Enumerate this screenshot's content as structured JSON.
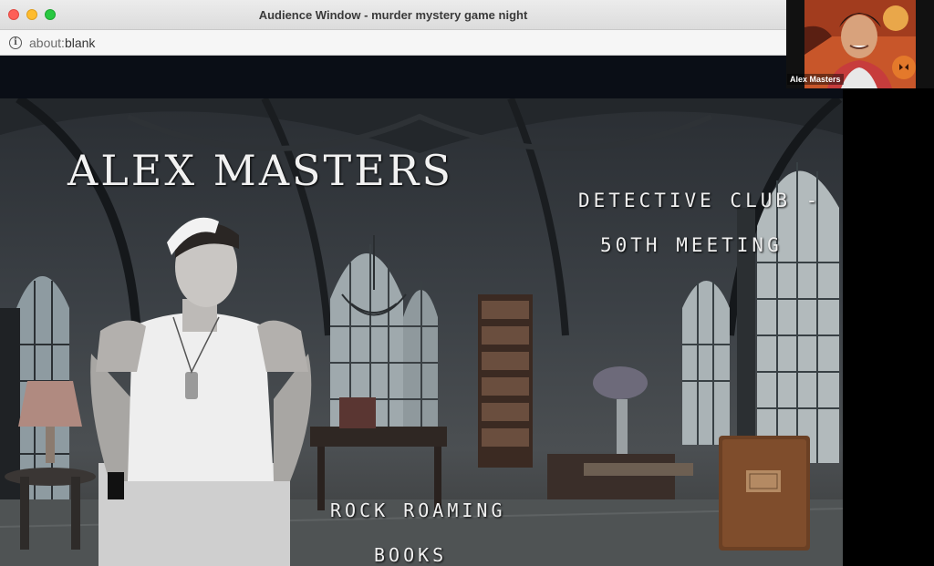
{
  "window": {
    "title": "Audience Window - murder mystery game night",
    "url_scheme": "about:",
    "url_rest": "blank"
  },
  "slide": {
    "title": "ALEX MASTERS",
    "club_line1": "DETECTIVE CLUB -",
    "club_line2": "50TH MEETING",
    "location_line1": "ROCK ROAMING",
    "location_line2": "BOOKS"
  },
  "participant": {
    "name": "Alex Masters"
  },
  "colors": {
    "close": "#fe5f57",
    "minimize": "#febc2e",
    "maximize": "#28c840",
    "video_bg": "#c8562a"
  }
}
